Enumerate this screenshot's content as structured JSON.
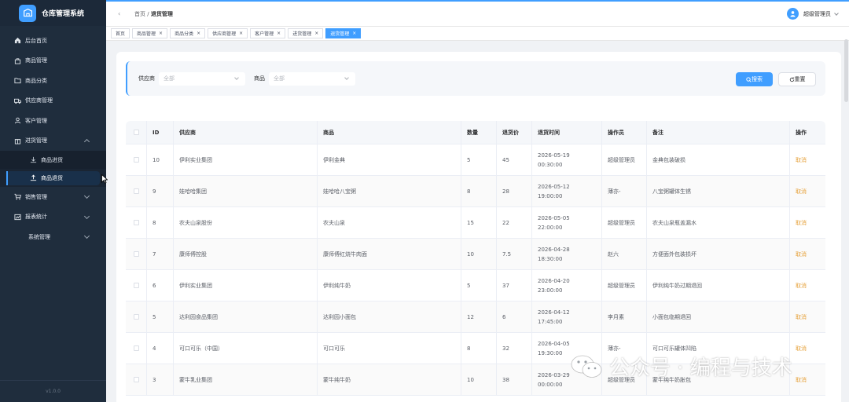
{
  "app": {
    "title": "仓库管理系统",
    "version": "v1.0.0"
  },
  "sidebar": {
    "items": [
      {
        "label": "后台首页",
        "icon": "home-icon"
      },
      {
        "label": "商品管理",
        "icon": "bag-icon"
      },
      {
        "label": "商品分类",
        "icon": "folder-icon"
      },
      {
        "label": "供应商管理",
        "icon": "truck-icon"
      },
      {
        "label": "客户管理",
        "icon": "user-icon"
      },
      {
        "label": "进货管理",
        "icon": "box-icon"
      },
      {
        "label": "商品进货",
        "icon": "download-icon"
      },
      {
        "label": "商品退货",
        "icon": "upload-icon"
      },
      {
        "label": "销售管理",
        "icon": "cart-icon"
      },
      {
        "label": "报表统计",
        "icon": "chart-icon"
      },
      {
        "label": "系统管理",
        "icon": ""
      }
    ]
  },
  "header": {
    "breadcrumb_home": "首页",
    "breadcrumb_sep": "/",
    "breadcrumb_current": "退货管理",
    "user_name": "超级管理员"
  },
  "tags": [
    {
      "label": "首页"
    },
    {
      "label": "商品管理"
    },
    {
      "label": "商品分类"
    },
    {
      "label": "供应商管理"
    },
    {
      "label": "客户管理"
    },
    {
      "label": "进货管理"
    },
    {
      "label": "退货管理"
    }
  ],
  "filter": {
    "supplier_label": "供应商",
    "supplier_placeholder": "全部",
    "product_label": "商品",
    "product_placeholder": "全部",
    "search_label": "搜索",
    "reset_label": "重置"
  },
  "table": {
    "headers": [
      "ID",
      "供应商",
      "商品",
      "数量",
      "退货价",
      "退货时间",
      "操作员",
      "备注",
      "操作"
    ],
    "rows": [
      {
        "id": "10",
        "supplier": "伊利实业集团",
        "product": "伊利金典",
        "qty": "5",
        "price": "45",
        "date": "2026-05-19",
        "time": "00:30:00",
        "operator": "超级管理员",
        "remark": "金典包装破损",
        "action": "取消"
      },
      {
        "id": "9",
        "supplier": "娃哈哈集团",
        "product": "娃哈哈八宝粥",
        "qty": "8",
        "price": "28",
        "date": "2026-05-12",
        "time": "19:00:00",
        "operator": "薄亦-",
        "remark": "八宝粥罐体生锈",
        "action": "取消"
      },
      {
        "id": "8",
        "supplier": "农夫山泉股份",
        "product": "农夫山泉",
        "qty": "15",
        "price": "22",
        "date": "2026-05-05",
        "time": "22:00:00",
        "operator": "超级管理员",
        "remark": "农夫山泉瓶盖漏水",
        "action": "取消"
      },
      {
        "id": "7",
        "supplier": "康师傅控股",
        "product": "康师傅红烧牛肉面",
        "qty": "10",
        "price": "7.5",
        "date": "2026-04-28",
        "time": "18:30:00",
        "operator": "赵六",
        "remark": "方便面外包装损坏",
        "action": "取消"
      },
      {
        "id": "6",
        "supplier": "伊利实业集团",
        "product": "伊利纯牛奶",
        "qty": "5",
        "price": "37",
        "date": "2026-04-20",
        "time": "23:00:00",
        "operator": "超级管理员",
        "remark": "伊利纯牛奶过期退回",
        "action": "取消"
      },
      {
        "id": "5",
        "supplier": "达利园食品集团",
        "product": "达利园小面包",
        "qty": "12",
        "price": "6",
        "date": "2026-04-12",
        "time": "17:45:00",
        "operator": "李月素",
        "remark": "小面包临期退回",
        "action": "取消"
      },
      {
        "id": "4",
        "supplier": "可口可乐（中国）",
        "product": "可口可乐",
        "qty": "8",
        "price": "32",
        "date": "2026-04-05",
        "time": "19:30:00",
        "operator": "薄亦-",
        "remark": "可口可乐罐体凹陷",
        "action": "取消"
      },
      {
        "id": "3",
        "supplier": "蒙牛乳业集团",
        "product": "蒙牛纯牛奶",
        "qty": "10",
        "price": "38",
        "date": "2026-03-29",
        "time": "00:00:00",
        "operator": "超级管理员",
        "remark": "蒙牛纯牛奶胀包",
        "action": "取消"
      }
    ]
  },
  "watermark": {
    "text": "公众号 · 编程与技术"
  },
  "colors": {
    "accent": "#409eff",
    "sidebar": "#1f2d3d",
    "cancel": "#e6a23c"
  }
}
